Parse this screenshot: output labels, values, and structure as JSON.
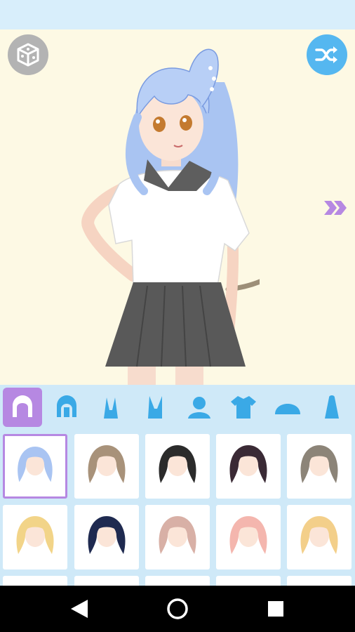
{
  "icons": {
    "randomize": "dice-icon",
    "shuffle": "shuffle-icon",
    "next": "double-chevron-right-icon",
    "back": "back-triangle-icon",
    "home": "home-circle-icon",
    "recents": "recents-square-icon"
  },
  "colors": {
    "accent_purple": "#b688e2",
    "accent_blue": "#55b7f0",
    "tab_icon_blue": "#3aa9e6",
    "panel_bg": "#cfe9f8",
    "stage_bg": "#fdf9e4"
  },
  "category_tabs": [
    {
      "name": "hair-front",
      "selected": true
    },
    {
      "name": "hair-back",
      "selected": false
    },
    {
      "name": "ears",
      "selected": false
    },
    {
      "name": "ears-alt",
      "selected": false
    },
    {
      "name": "body",
      "selected": false
    },
    {
      "name": "top",
      "selected": false
    },
    {
      "name": "hat",
      "selected": false
    },
    {
      "name": "accessory",
      "selected": false
    }
  ],
  "hair_options": [
    {
      "color": "#a9c4f2",
      "selected": true
    },
    {
      "color": "#a8927a",
      "selected": false
    },
    {
      "color": "#2b2b2b",
      "selected": false
    },
    {
      "color": "#3a2a35",
      "selected": false
    },
    {
      "color": "#8c8478",
      "selected": false
    },
    {
      "color": "#f2d488",
      "selected": false
    },
    {
      "color": "#1f2a50",
      "selected": false
    },
    {
      "color": "#d8b0a6",
      "selected": false
    },
    {
      "color": "#f4b6ae",
      "selected": false
    },
    {
      "color": "#f3cf8a",
      "selected": false
    }
  ]
}
